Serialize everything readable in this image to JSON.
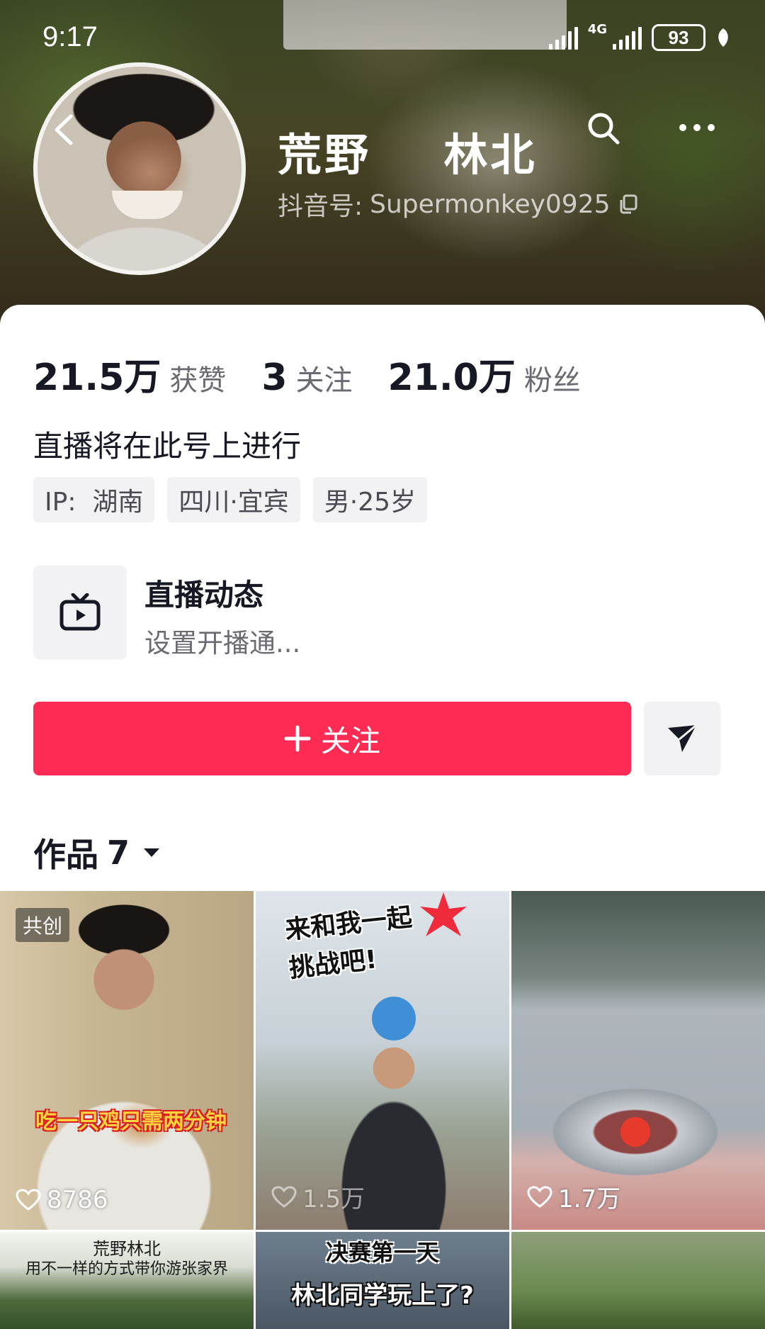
{
  "status_bar": {
    "time": "9:17",
    "network": "4G",
    "battery": "93"
  },
  "profile": {
    "name": "荒野    林北",
    "douyin_id_label": "抖音号:",
    "douyin_id": "Supermonkey0925",
    "avatar": "profile-photo"
  },
  "stats": [
    {
      "value": "21.5万",
      "label": "获赞"
    },
    {
      "value": "3",
      "label": "关注"
    },
    {
      "value": "21.0万",
      "label": "粉丝"
    }
  ],
  "bio": "直播将在此号上进行",
  "tags": [
    "IP:  湖南",
    "四川·宜宾",
    "男·25岁"
  ],
  "live": {
    "title": "直播动态",
    "subtitle": "设置开播通..."
  },
  "actions": {
    "follow_label": "关注",
    "accent_color": "#fe2c55"
  },
  "works": {
    "tab_label": "作品",
    "count": "7"
  },
  "videos": [
    {
      "badge": "共创",
      "caption": "吃一只鸡只需两分钟",
      "likes": "8786"
    },
    {
      "caption_lines": [
        "来和我一起",
        "挑战吧!"
      ],
      "likes": "1.5万"
    },
    {
      "likes": "1.7万"
    },
    {
      "caption_lines": [
        "荒野林北",
        "用不一样的方式带你游张家界"
      ]
    },
    {
      "caption_lines": [
        "决赛第一天",
        "林北同学玩上了?"
      ]
    },
    {}
  ]
}
